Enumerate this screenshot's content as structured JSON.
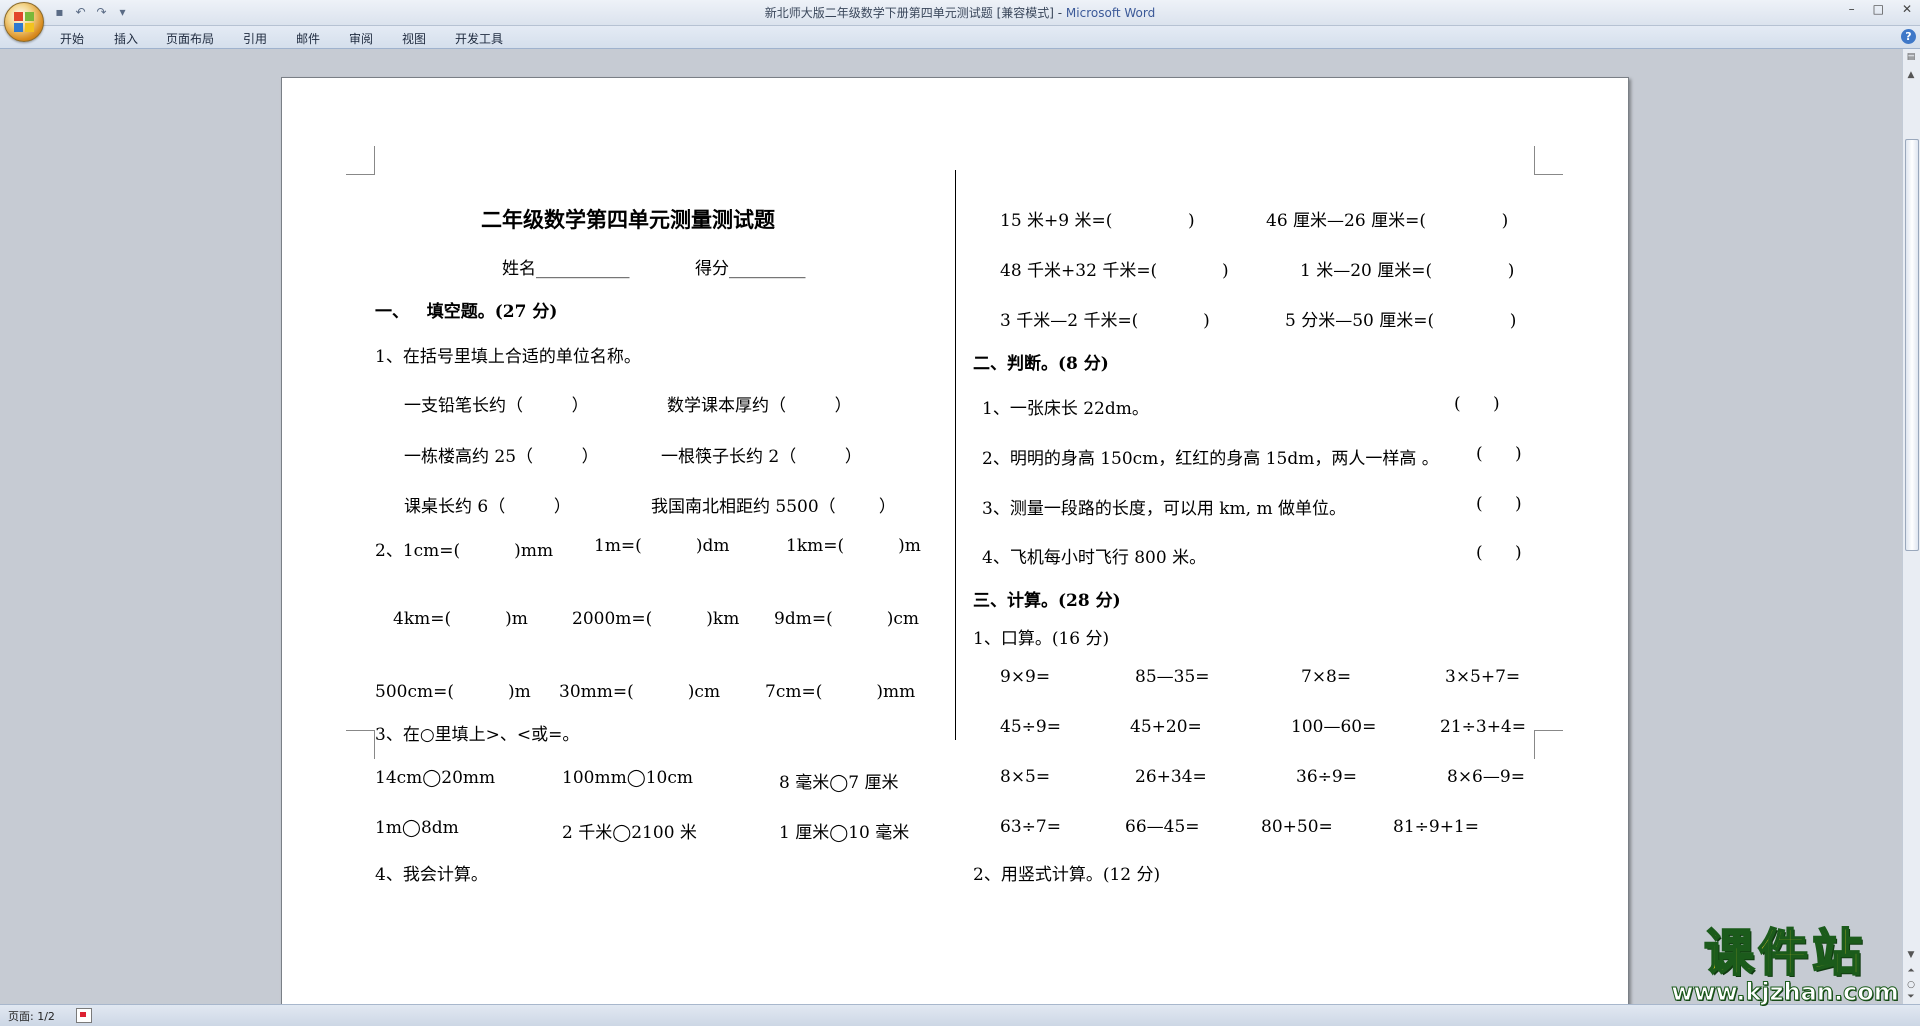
{
  "window": {
    "title_doc": "新北师大版二年级数学下册第四单元测试题 [兼容模式] - ",
    "title_app": "Microsoft Word"
  },
  "ribbon_tabs": [
    "开始",
    "插入",
    "页面布局",
    "引用",
    "邮件",
    "审阅",
    "视图",
    "开发工具"
  ],
  "status": {
    "page": "页面: 1/2"
  },
  "watermark": {
    "line1": "课件站",
    "line2": "www.kjzhan.com"
  },
  "doc": {
    "title": "二年级数学第四单元测量测试题",
    "name_line": "姓名___________",
    "score_line": "得分_________",
    "sec1_heading": "一、   填空题。(27 分)",
    "q1": "1、在括号里填上合适的单位名称。",
    "q1_r1a": "一支铅笔长约（         ）",
    "q1_r1b": "数学课本厚约（         ）",
    "q1_r2a": "一栋楼高约 25（         ）",
    "q1_r2b": "一根筷子长约 2（         ）",
    "q1_r3a": "课桌长约 6（         ）",
    "q1_r3b": "我国南北相距约 5500（        ）",
    "q2_label": "2、1cm=(          )mm",
    "q2_b": "1m=(          )dm",
    "q2_c": "1km=(          )m",
    "q2_r2a": "4km=(          )m",
    "q2_r2b": "2000m=(          )km",
    "q2_r2c": "9dm=(          )cm",
    "q2_r3a": "500cm=(          )m",
    "q2_r3b": "30mm=(          )cm",
    "q2_r3c": "7cm=(          )mm",
    "q3": "3、在○里填上>、<或=。",
    "q3_r1a": "14cm◯20mm",
    "q3_r1b": "100mm◯10cm",
    "q3_r1c": "8 毫米◯7 厘米",
    "q3_r2a": "1m◯8dm",
    "q3_r2b": "2 千米◯2100 米",
    "q3_r2c": "1 厘米◯10 毫米",
    "q4": "4、我会计算。",
    "r_c1a": "15 米+9 米=(              )",
    "r_c1b": "46 厘米—26 厘米=(              )",
    "r_c2a": "48 千米+32 千米=(            )",
    "r_c2b": "1 米—20 厘米=(              )",
    "r_c3a": "3 千米—2 千米=(            )",
    "r_c3b": "5 分米—50 厘米=(              )",
    "sec2_heading": "二、判断。(8 分)",
    "j1": "1、一张床长 22dm。",
    "j1_p": "(      )",
    "j2": "2、明明的身高 150cm，红红的身高 15dm，两人一样高 。",
    "j2_p": "(      )",
    "j3": "3、测量一段路的长度，可以用 km, m 做单位。",
    "j3_p": "(      )",
    "j4": "4、飞机每小时飞行 800 米。",
    "j4_p": "(      )",
    "sec3_heading": "三、计算。(28 分)",
    "calc1": "1、口算。(16 分)",
    "k": [
      [
        "9×9=",
        "85—35=",
        "7×8=",
        "3×5+7="
      ],
      [
        "45÷9=",
        "45+20=",
        "100—60=",
        "21÷3+4="
      ],
      [
        "8×5=",
        "26+34=",
        "36÷9=",
        "8×6—9="
      ],
      [
        "63÷7=",
        "66—45=",
        "80+50=",
        "81÷9+1="
      ]
    ],
    "calc2": "2、用竖式计算。(12 分)"
  }
}
